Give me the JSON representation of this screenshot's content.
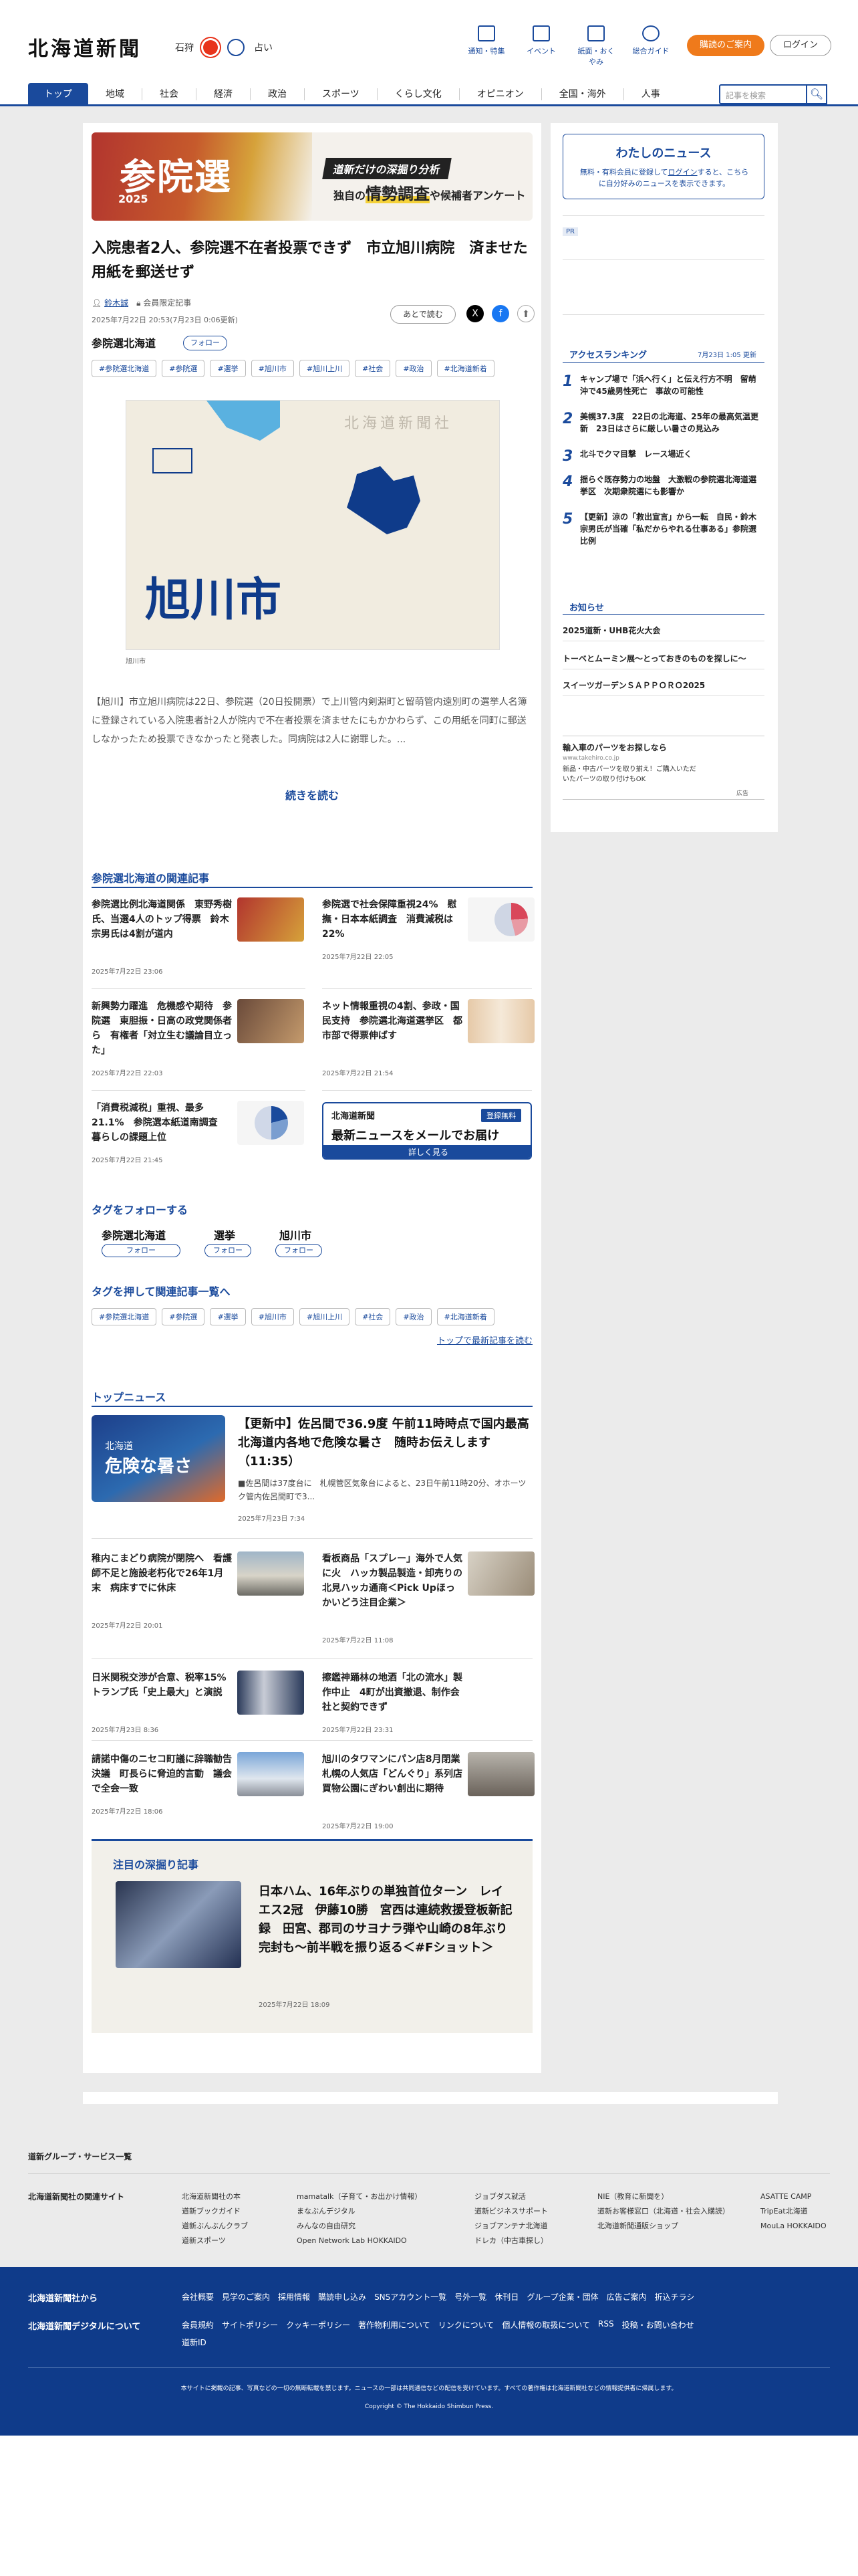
{
  "header": {
    "logo": "北海道新聞",
    "weather": {
      "city": "石狩",
      "now": "晴",
      "icon": "sun-icon",
      "next": "占い"
    },
    "icons": [
      {
        "label": "通知・特集",
        "icon": "flag-icon"
      },
      {
        "label": "イベント",
        "icon": "calendar-icon"
      },
      {
        "label": "紙面・おくやみ",
        "icon": "newspaper-icon"
      },
      {
        "label": "総合ガイド",
        "icon": "help-icon"
      }
    ],
    "register": "購読のご案内",
    "login": "ログイン",
    "search_placeholder": "記事を検索"
  },
  "nav": [
    "トップ",
    "地域",
    "社会",
    "経済",
    "政治",
    "スポーツ",
    "くらし文化",
    "オピニオン",
    "全国・海外",
    "人事"
  ],
  "banner": {
    "kanji": "参院選",
    "year": "2025",
    "tag": "道新だけの深掘り分析",
    "sub_pre": "独自の",
    "sub_em": "情勢調査",
    "sub_post": "や候補者アンケート"
  },
  "article": {
    "title": "入院患者2人、参院選不在者投票できず　市立旭川病院　済ませた用紙を郵送せず",
    "author": "鈴木誠",
    "author_note": "会員限定記事",
    "date": "2025年7月22日 20:53(7月23日 0:06更新)",
    "later": "あとで読む",
    "tag_title": "参院選北海道",
    "follow": "フォロー",
    "tags": [
      "#参院選北海道",
      "#参院選",
      "#選挙",
      "#旭川市",
      "#旭川上川",
      "#社会",
      "#政治",
      "#北海道新着"
    ],
    "map_label": "旭川市",
    "map_brand": "北海道新聞社",
    "caption": "旭川市",
    "lead": "【旭川】市立旭川病院は22日、参院選（20日投開票）で上川管内剣淵町と留萌管内遠別町の選挙人名簿に登録されている入院患者計2人が院内で不在者投票を済ませたにもかかわらず、この用紙を同町に郵送しなかったため投票できなかったと発表した。同病院は2人に謝罪した。...",
    "more": "続きを読む"
  },
  "related": {
    "title": "参院選北海道の関連記事",
    "items": [
      {
        "title": "参院選比例北海道関係　東野秀樹氏、当選4人のトップ得票　鈴木宗男氏は4割が道内",
        "date": "2025年7月22日 23:06"
      },
      {
        "title": "参院選で社会保障重視24%　慰撫・日本本紙調査　消費減税は22%",
        "date": "2025年7月22日 22:05"
      },
      {
        "title": "新興勢力躍進　危機感や期待　参院選　東胆振・日高の政党関係者ら　有権者「対立生む議論目立った」",
        "date": "2025年7月22日 22:03"
      },
      {
        "title": "ネット情報重視の4割、参政・国民支持　参院選北海道選挙区　都市部で得票伸ばす",
        "date": "2025年7月22日 21:54"
      },
      {
        "title": "「消費税減税」重視、最多21.1%　参院選本紙道南調査　暮らしの課題上位",
        "date": "2025年7月22日 21:45"
      }
    ],
    "mail": {
      "brand": "北海道新聞",
      "badge": "登録無料",
      "title": "最新ニュースをメールでお届け",
      "more": "詳しく見る"
    }
  },
  "follow_tags": {
    "title": "タグをフォローする",
    "items": [
      "参院選北海道",
      "選挙",
      "旭川市"
    ],
    "follow": "フォロー"
  },
  "tag_links": {
    "title": "タグを押して関連記事一覧へ",
    "tags": [
      "#参院選北海道",
      "#参院選",
      "#選挙",
      "#旭川市",
      "#旭川上川",
      "#社会",
      "#政治",
      "#北海道新着"
    ],
    "latest": "トップで最新記事を読む"
  },
  "top_news": {
    "title": "トップニュース",
    "lead": {
      "img_text": "北海道",
      "img_big": "危険な暑さ",
      "title": "【更新中】佐呂間で36.9度 午前11時時点で国内最高　北海道内各地で危険な暑さ　随時お伝えします（11:35）",
      "desc": "■佐呂間は37度台に　札幌管区気象台によると、23日午前11時20分、オホーツク管内佐呂間町で3...",
      "date": "2025年7月23日 7:34"
    },
    "items": [
      {
        "title": "稚内こまどり病院が閉院へ　看護師不足と施設老朽化で26年1月末　病床すでに休床",
        "date": "2025年7月22日 20:01"
      },
      {
        "title": "看板商品「スプレー」海外で人気に火　ハッカ製品製造・卸売りの北見ハッカ通商＜Pick Upほっかいどう注目企業＞",
        "date": "2025年7月22日 11:08"
      },
      {
        "title": "日米関税交渉が合意、税率15%　トランプ氏「史上最大」と演説",
        "date": "2025年7月23日 8:36"
      },
      {
        "title": "擦鑑神踊林の地酒「北の流水」製作中止　4町が出資撤退、制作会社と契約できず",
        "date": "2025年7月22日 23:31"
      },
      {
        "title": "請諾中傷のニセコ町議に辞職勧告決議　町長らに脅迫的言動　議会で全会一致",
        "date": "2025年7月22日 18:06"
      },
      {
        "title": "旭川のタワマンにパン店8月閉業　札幌の人気店「どんぐり」系列店　買物公園にぎわい創出に期待",
        "date": "2025年7月22日 19:00"
      }
    ]
  },
  "deep": {
    "title": "注目の深掘り記事",
    "article": "日本ハム、16年ぶりの単独首位ターン　レイエス2冠　伊藤10勝　宮西は連続救援登板新記録　田宮、郡司のサヨナラ弾や山崎の8年ぶり完封も～前半戦を振り返る＜#Fショット＞",
    "date": "2025年7月22日 18:09"
  },
  "sidebar": {
    "my_news": {
      "title": "わたしのニュース",
      "desc1": "無料・有料会員に登録して",
      "login": "ログイン",
      "desc2": "すると、こちらに自分好みのニュースを表示できます。"
    },
    "pr": "PR",
    "ranking": {
      "title": "アクセスランキング",
      "updated": "7月23日 1:05 更新",
      "items": [
        {
          "rank": "1",
          "text": "キャンプ場で「浜へ行く」と伝え行方不明　留萌沖で45歳男性死亡　事故の可能性"
        },
        {
          "rank": "2",
          "text": "美幌37.3度　22日の北海道、25年の最高気温更新　23日はさらに厳しい暑さの見込み"
        },
        {
          "rank": "3",
          "text": "北斗でクマ目撃　レース場近く"
        },
        {
          "rank": "4",
          "text": "揺らぐ既存勢力の地盤　大激戦の参院選北海道選挙区　次期衆院選にも影響か"
        },
        {
          "rank": "5",
          "text": "【更新】涼の「救出宣言」から一転　自民・鈴木宗男氏が当確「私だからやれる仕事ある」参院選比例"
        }
      ]
    },
    "notice": {
      "title": "お知らせ",
      "items": [
        "2025道新・UHB花火大会",
        "トーベとムーミン展～とっておきのものを探しに～",
        "スイーツガーデンＳＡＰＰＯＲＯ2025"
      ]
    },
    "ad": {
      "title": "輸入車のパーツをお探しなら",
      "url": "www.takehiro.co.jp",
      "desc": "新品・中古パーツを取り揃え！ご購入いただいたパーツの取り付けもOK",
      "label": "広告"
    }
  },
  "footer": {
    "group_link": "道新グループ・サービス一覧",
    "related_title": "北海道新聞社の関連サイト",
    "sites": [
      [
        "北海道新聞社の本",
        "道新ブックガイド",
        "道新ぶんぶんクラブ",
        "道新スポーツ"
      ],
      [
        "mamatalk（子育て・お出かけ情報）",
        "まなぶんデジタル",
        "みんなの自由研究",
        "Open Network Lab HOKKAIDO"
      ],
      [
        "ジョブダス就活",
        "道新ビジネスサポート",
        "ジョブアンテナ北海道",
        "ドレカ（中古車探し）"
      ],
      [
        "NIE（教育に新聞を）",
        "道新お客様窓口（北海道・社会入購読）",
        "北海道新聞通販ショップ"
      ],
      [
        "ASATTE CAMP",
        "TripEat北海道",
        "MouLa HOKKAIDO"
      ]
    ],
    "blue": {
      "h1": "北海道新聞社から",
      "links1": [
        "会社概要",
        "見学のご案内",
        "採用情報",
        "購読申し込み",
        "SNSアカウント一覧",
        "号外一覧",
        "休刊日",
        "グループ企業・団体",
        "広告ご案内",
        "折込チラシ"
      ],
      "h2": "北海道新聞デジタルについて",
      "links2": [
        "会員規約",
        "サイトポリシー",
        "クッキーポリシー",
        "著作物利用について",
        "リンクについて",
        "個人情報の取扱について",
        "RSS",
        "投稿・お問い合わせ",
        "道新ID"
      ],
      "note": "本サイトに掲載の記事、写真などの一切の無断転載を禁じます。ニュースの一部は共同通信などの配信を受けています。すべての著作権は北海道新聞社などの情報提供者に帰属します。",
      "copyright": "Copyright © The Hokkaido Shimbun Press."
    }
  }
}
